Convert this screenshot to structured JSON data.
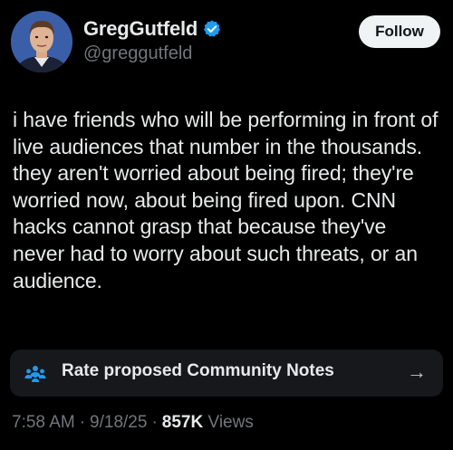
{
  "author": {
    "display_name": "GregGutfeld",
    "handle": "@greggutfeld",
    "verified": true,
    "verified_badge_color": "#1d9bf0",
    "avatar_icon": "profile-photo"
  },
  "follow_button": {
    "label": "Follow"
  },
  "tweet": {
    "text": "i have friends who will be performing in front of live audiences that number in the thousands. they aren't worried about being fired; they're worried now, about being fired upon. CNN hacks cannot grasp that because they've never had to worry about such threats, or an audience."
  },
  "community_notes": {
    "icon": "people-group-icon",
    "label": "Rate proposed Community Notes",
    "arrow": "→",
    "accent_color": "#1d9bf0"
  },
  "meta": {
    "time": "7:58 AM",
    "separator_1": "·",
    "date": "9/18/25",
    "separator_2": "·",
    "views_count": "857K",
    "views_label": "Views"
  },
  "colors": {
    "background": "#000000",
    "text_primary": "#e7e9ea",
    "text_secondary": "#71767b",
    "card_background": "#16181c"
  }
}
